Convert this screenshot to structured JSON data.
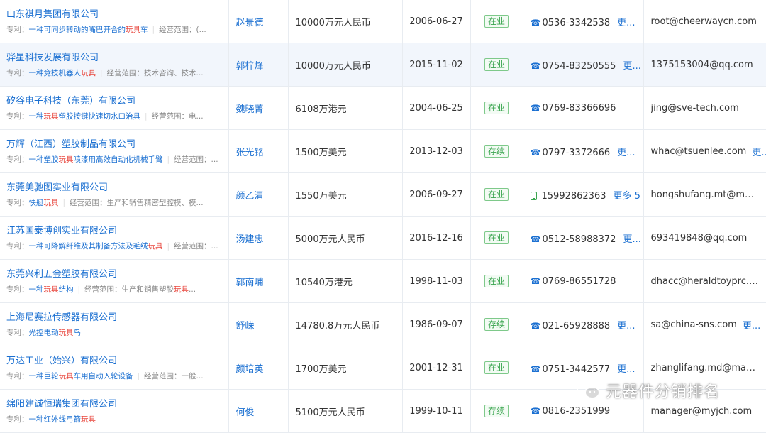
{
  "labels": {
    "patent": "专利：",
    "scope": "经营范围：",
    "more": "更..."
  },
  "rows": [
    {
      "name": "山东祺月集团有限公司",
      "patent_pre": "一种可同步转动的嘴巴开合的",
      "patent_kw": "玩具",
      "patent_post": "车",
      "scope_text": "(...",
      "person": "赵景德",
      "capital": "10000万元人民币",
      "date": "2006-06-27",
      "status": "在业",
      "phone_type": "tel",
      "phone": "0536-3342538",
      "phone_more": "更...",
      "email": "root@cheerwaycn.com",
      "email_more": ""
    },
    {
      "name": "骅星科技发展有限公司",
      "patent_pre": "一种竞技机器人",
      "patent_kw": "玩具",
      "patent_post": "",
      "scope_text": "技术咨询、技术...",
      "person": "郭梓烽",
      "capital": "10000万元人民币",
      "date": "2015-11-02",
      "status": "在业",
      "phone_type": "tel",
      "phone": "0754-83250555",
      "phone_more": "更...",
      "email": "1375153004@qq.com",
      "email_more": ""
    },
    {
      "name": "矽谷电子科技（东莞）有限公司",
      "patent_pre": "一种",
      "patent_kw": "玩具",
      "patent_post": "塑胶按键快速切水口治具",
      "scope_text": "电...",
      "person": "魏晓菁",
      "capital": "6108万港元",
      "date": "2004-06-25",
      "status": "在业",
      "phone_type": "tel",
      "phone": "0769-83366696",
      "phone_more": "",
      "email": "jing@sve-tech.com",
      "email_more": ""
    },
    {
      "name": "万辉（江西）塑胶制品有限公司",
      "patent_pre": "一种塑胶",
      "patent_kw": "玩具",
      "patent_post": "喷漆用高效自动化机械手臂",
      "scope_text": "...",
      "person": "张光铭",
      "capital": "1500万美元",
      "date": "2013-12-03",
      "status": "存续",
      "phone_type": "tel",
      "phone": "0797-3372666",
      "phone_more": "更...",
      "email": "whac@tsuenlee.com",
      "email_more": "更..."
    },
    {
      "name": "东莞美驰图实业有限公司",
      "patent_pre": "快艇",
      "patent_kw": "玩具",
      "patent_post": "",
      "scope_text": "生产和销售精密型腔模、模...",
      "person": "颜乙清",
      "capital": "1550万美元",
      "date": "2006-09-27",
      "status": "在业",
      "phone_type": "mobile",
      "phone": "15992862363",
      "phone_more": "更多 5",
      "email": "hongshufang.mt@mayco...",
      "email_more": ""
    },
    {
      "name": "江苏国泰博创实业有限公司",
      "patent_pre": "一种可降解纤维及其制备方法及毛绒",
      "patent_kw": "玩具",
      "patent_post": "",
      "scope_text": "...",
      "person": "汤建忠",
      "capital": "5000万元人民币",
      "date": "2016-12-16",
      "status": "在业",
      "phone_type": "tel",
      "phone": "0512-58988372",
      "phone_more": "更...",
      "email": "693419848@qq.com",
      "email_more": ""
    },
    {
      "name": "东莞兴利五金塑胶有限公司",
      "patent_pre": "一种",
      "patent_kw": "玩具",
      "patent_post": "结构",
      "scope_text": "生产和销售塑胶",
      "scope_kw": "玩具",
      "scope_post": "...",
      "person": "郭南埔",
      "capital": "10540万港元",
      "date": "1998-11-03",
      "status": "在业",
      "phone_type": "tel",
      "phone": "0769-86551728",
      "phone_more": "",
      "email": "dhacc@heraldtoyprc.com",
      "email_more": ""
    },
    {
      "name": "上海尼赛拉传感器有限公司",
      "patent_pre": "光控电动",
      "patent_kw": "玩具",
      "patent_post": "鸟",
      "scope_text": "",
      "person": "舒嵘",
      "capital": "14780.8万元人民币",
      "date": "1986-09-07",
      "status": "存续",
      "phone_type": "tel",
      "phone": "021-65928888",
      "phone_more": "更...",
      "email": "sa@china-sns.com",
      "email_more": "更..."
    },
    {
      "name": "万达工业（始兴）有限公司",
      "patent_pre": "一种巨轮",
      "patent_kw": "玩具",
      "patent_post": "车用自动入轮设备",
      "scope_text": "一般...",
      "person": "颜培英",
      "capital": "1700万美元",
      "date": "2001-12-31",
      "status": "在业",
      "phone_type": "tel",
      "phone": "0751-3442577",
      "phone_more": "更...",
      "email": "zhanglifang.md@mayco...",
      "email_more": ""
    },
    {
      "name": "绵阳建诚恒瑞集团有限公司",
      "patent_pre": "一种红外线弓箭",
      "patent_kw": "玩具",
      "patent_post": "",
      "scope_text": "",
      "person": "何俊",
      "capital": "5100万元人民币",
      "date": "1999-10-11",
      "status": "存续",
      "phone_type": "tel",
      "phone": "0816-2351999",
      "phone_more": "",
      "email": "manager@myjch.com",
      "email_more": ""
    }
  ],
  "watermark": {
    "text": "元器件分销排名",
    "icon": "wechat-icon"
  },
  "colors": {
    "link": "#1a6fd1",
    "keyword": "#e8453c",
    "status": "#3aa54f",
    "border": "#e8ecf1"
  }
}
